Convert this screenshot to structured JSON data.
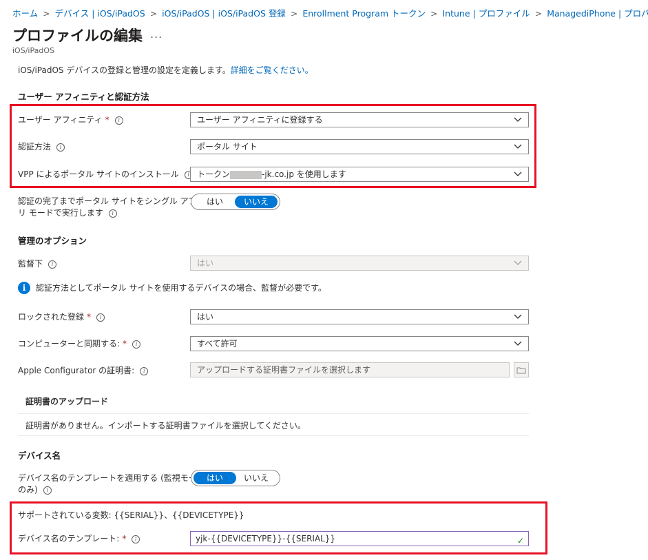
{
  "breadcrumbs": [
    "ホーム",
    "デバイス | iOS/iPadOS",
    "iOS/iPadOS | iOS/iPadOS 登録",
    "Enrollment Program トークン",
    "Intune | プロファイル",
    "ManagediPhone | プロパティ"
  ],
  "header": {
    "title": "プロファイルの編集",
    "more": "...",
    "subtitle": "iOS/iPadOS"
  },
  "description": {
    "text": "iOS/iPadOS デバイスの登録と管理の設定を定義します。",
    "link": "詳細をご覧ください。"
  },
  "sections": {
    "user_affinity": "ユーザー アフィニティと認証方法",
    "management": "管理のオプション",
    "device_name": "デバイス名"
  },
  "fields": {
    "user_affinity": {
      "label": "ユーザー アフィニティ",
      "value": "ユーザー アフィニティに登録する"
    },
    "auth_method": {
      "label": "認証方法",
      "value": "ポータル サイト"
    },
    "vpp_install": {
      "label": "VPP によるポータル サイトのインストール",
      "value_prefix": "トークン",
      "value_suffix": "-jk.co.jp を使用します"
    },
    "single_app": {
      "label_line1": "認証の完了までポータル サイトをシングル アプ",
      "label_line2": "リ モードで実行します",
      "yes": "はい",
      "no": "いいえ",
      "selected": "いいえ"
    },
    "supervised": {
      "label": "監督下",
      "value": "はい"
    },
    "supervised_info": "認証方法としてポータル サイトを使用するデバイスの場合、監督が必要です。",
    "locked_enrollment": {
      "label": "ロックされた登録",
      "value": "はい"
    },
    "sync_computer": {
      "label": "コンピューターと同期する:",
      "value": "すべて許可"
    },
    "apple_configurator": {
      "label": "Apple Configurator の証明書:",
      "placeholder": "アップロードする証明書ファイルを選択します"
    },
    "cert_upload_title": "証明書のアップロード",
    "cert_upload_empty": "証明書がありません。インポートする証明書ファイルを選択してください。",
    "apply_template": {
      "label_line1": "デバイス名のテンプレートを適用する (監視モード",
      "label_line2": "のみ)",
      "yes": "はい",
      "no": "いいえ",
      "selected": "はい"
    },
    "supported_vars": "サポートされている変数: {{SERIAL}}、{{DEVICETYPE}}",
    "name_template": {
      "label": "デバイス名のテンプレート:",
      "value": "yjk-{{DEVICETYPE}}-{{SERIAL}}"
    }
  },
  "colors": {
    "accent": "#0078d4",
    "highlight": "#e81123",
    "link": "#0067b8"
  }
}
